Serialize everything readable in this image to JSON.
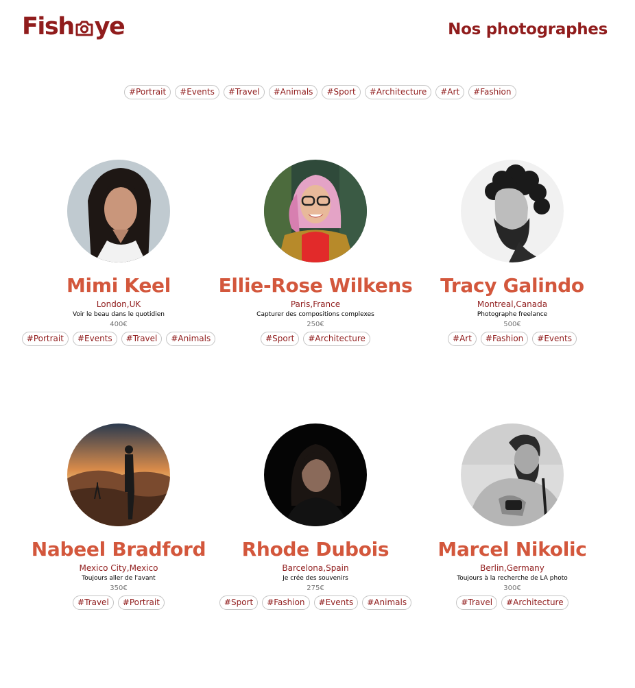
{
  "header": {
    "logo_prefix": "Fish",
    "logo_suffix": "ye",
    "logo_icon": "camera-icon",
    "page_title": "Nos photographes"
  },
  "filters": [
    "#Portrait",
    "#Events",
    "#Travel",
    "#Animals",
    "#Sport",
    "#Architecture",
    "#Art",
    "#Fashion"
  ],
  "photographers": [
    {
      "name": "Mimi Keel",
      "location": "London,UK",
      "tagline": "Voir le beau dans le quotidien",
      "price": "400€",
      "tags": [
        "#Portrait",
        "#Events",
        "#Travel",
        "#Animals"
      ]
    },
    {
      "name": "Ellie-Rose Wilkens",
      "location": "Paris,France",
      "tagline": "Capturer des compositions complexes",
      "price": "250€",
      "tags": [
        "#Sport",
        "#Architecture"
      ]
    },
    {
      "name": "Tracy Galindo",
      "location": "Montreal,Canada",
      "tagline": "Photographe freelance",
      "price": "500€",
      "tags": [
        "#Art",
        "#Fashion",
        "#Events"
      ]
    },
    {
      "name": "Nabeel Bradford",
      "location": "Mexico City,Mexico",
      "tagline": "Toujours aller de l'avant",
      "price": "350€",
      "tags": [
        "#Travel",
        "#Portrait"
      ]
    },
    {
      "name": "Rhode Dubois",
      "location": "Barcelona,Spain",
      "tagline": "Je crée des souvenirs",
      "price": "275€",
      "tags": [
        "#Sport",
        "#Fashion",
        "#Events",
        "#Animals"
      ]
    },
    {
      "name": "Marcel Nikolic",
      "location": "Berlin,Germany",
      "tagline": "Toujours à la recherche de LA photo",
      "price": "300€",
      "tags": [
        "#Travel",
        "#Architecture"
      ]
    }
  ],
  "colors": {
    "brand": "#901C1C",
    "accent": "#D3573C",
    "tag_border": "#C4C4C4",
    "price": "#757575"
  }
}
